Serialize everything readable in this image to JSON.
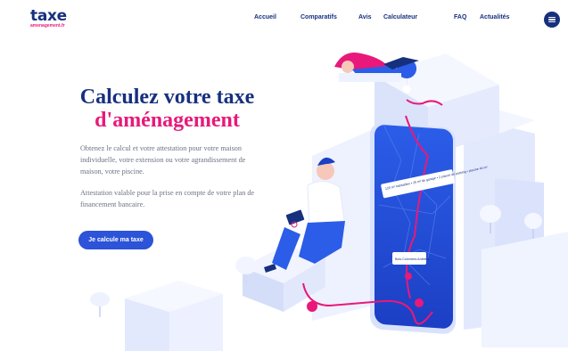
{
  "brand": {
    "name": "taxe",
    "tagline": "amenagement.fr",
    "color": "#17307e",
    "accent": "#e8197a"
  },
  "nav": {
    "items": [
      {
        "label": "Accueil"
      },
      {
        "label": "Comparatifs"
      },
      {
        "label": "Avis"
      },
      {
        "label": "Calculateur"
      },
      {
        "label": "FAQ"
      },
      {
        "label": "Actualités"
      }
    ],
    "menu_icon": "hamburger-icon"
  },
  "hero": {
    "title_line1": "Calculez votre taxe",
    "title_line2": "d'aménagement",
    "paragraph1": "Obtenez le calcul et votre attestation pour votre maison individuelle, votre extension ou votre agrandissement de maison, votre piscine.",
    "paragraph2": "Attestation valable pour la prise en compte de votre plan de financement bancaire.",
    "cta_label": "Je calcule ma taxe",
    "cta_color": "#2c53d8"
  },
  "illustration": {
    "map_callout1": "120 m² habitables • 25 m² de garage • 2 places de parking • piscine 40 m²",
    "map_callout2": "Bois-Colombes\nArdèle 8"
  }
}
